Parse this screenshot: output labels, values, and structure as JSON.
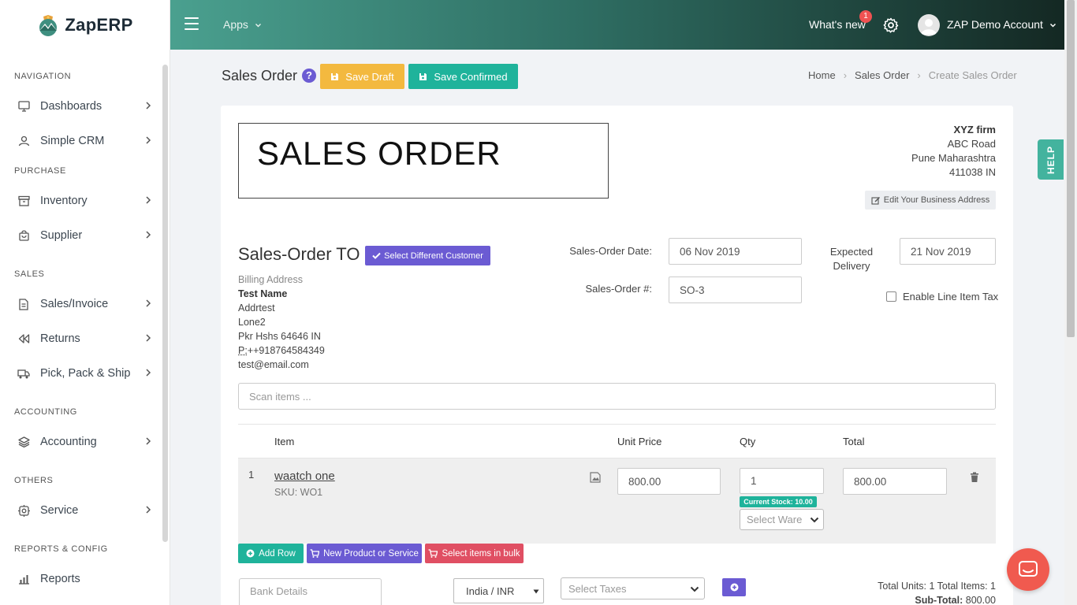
{
  "brand": {
    "name": "ZapERP"
  },
  "topbar": {
    "apps_label": "Apps",
    "whats_new": "What's new",
    "notif_count": "1",
    "account": "ZAP Demo Account"
  },
  "sidebar": {
    "sections": {
      "navigation": "NAVIGATION",
      "purchase": "PURCHASE",
      "sales": "SALES",
      "accounting": "ACCOUNTING",
      "others": "OTHERS",
      "reports": "REPORTS & CONFIG"
    },
    "items": [
      {
        "label": "Dashboards",
        "icon": "monitor-icon"
      },
      {
        "label": "Simple CRM",
        "icon": "user-icon"
      },
      {
        "label": "Inventory",
        "icon": "archive-icon"
      },
      {
        "label": "Supplier",
        "icon": "bag-icon"
      },
      {
        "label": "Sales/Invoice",
        "icon": "document-icon"
      },
      {
        "label": "Returns",
        "icon": "rewind-icon"
      },
      {
        "label": "Pick, Pack & Ship",
        "icon": "truck-icon"
      },
      {
        "label": "Accounting",
        "icon": "layers-icon"
      },
      {
        "label": "Service",
        "icon": "cog-box-icon"
      },
      {
        "label": "Reports",
        "icon": "bar-chart-icon"
      }
    ]
  },
  "header": {
    "title": "Sales Order",
    "save_draft": "Save Draft",
    "save_confirmed": "Save Confirmed",
    "breadcrumb": [
      "Home",
      "Sales Order",
      "Create Sales Order"
    ]
  },
  "doc": {
    "heading": "SALES ORDER",
    "business": {
      "name": "XYZ firm",
      "line1": "ABC Road",
      "line2": "Pune Maharashtra",
      "line3": "411038 IN",
      "edit_label": "Edit Your Business Address"
    },
    "to_title": "Sales-Order TO",
    "select_customer": "Select Different Customer",
    "billing": {
      "label": "Billing Address",
      "name": "Test Name",
      "line1": "Addrtest",
      "line2": "Lone2",
      "line3": "Pkr Hshs 64646 IN",
      "phone_prefix": "P:",
      "phone": "++918764584349",
      "email": "test@email.com"
    },
    "date_label": "Sales-Order Date:",
    "date_value": "06 Nov 2019",
    "number_label": "Sales-Order #:",
    "number_value": "SO-3",
    "expected_label_1": "Expected",
    "expected_label_2": "Delivery",
    "expected_value": "21 Nov 2019",
    "line_tax_label": "Enable Line Item Tax",
    "scan_placeholder": "Scan items ..."
  },
  "table": {
    "headers": {
      "item": "Item",
      "unit_price": "Unit Price",
      "qty": "Qty",
      "total": "Total"
    },
    "rows": [
      {
        "num": "1",
        "name": "waatch one",
        "sku": "SKU: WO1",
        "unit_price": "800.00",
        "qty": "1",
        "stock": "Current Stock: 10.00",
        "warehouse_placeholder": "Select Ware",
        "total": "800.00"
      }
    ]
  },
  "actions": {
    "add_row": "Add Row",
    "new_product": "New Product or Service",
    "bulk": "Select items in bulk"
  },
  "footer": {
    "bank_placeholder": "Bank Details",
    "currency": "India / INR",
    "taxes_placeholder": "Select Taxes",
    "totals_line": "Total Units: 1 Total Items: 1",
    "subtotal_label": "Sub-Total:",
    "subtotal_value": "800.00"
  },
  "help_tab": "HELP",
  "colors": {
    "primary_teal": "#1fb39b",
    "warning": "#f3b93f",
    "purple": "#6b5bd3",
    "danger": "#e04f63",
    "chat": "#f05a4f"
  }
}
